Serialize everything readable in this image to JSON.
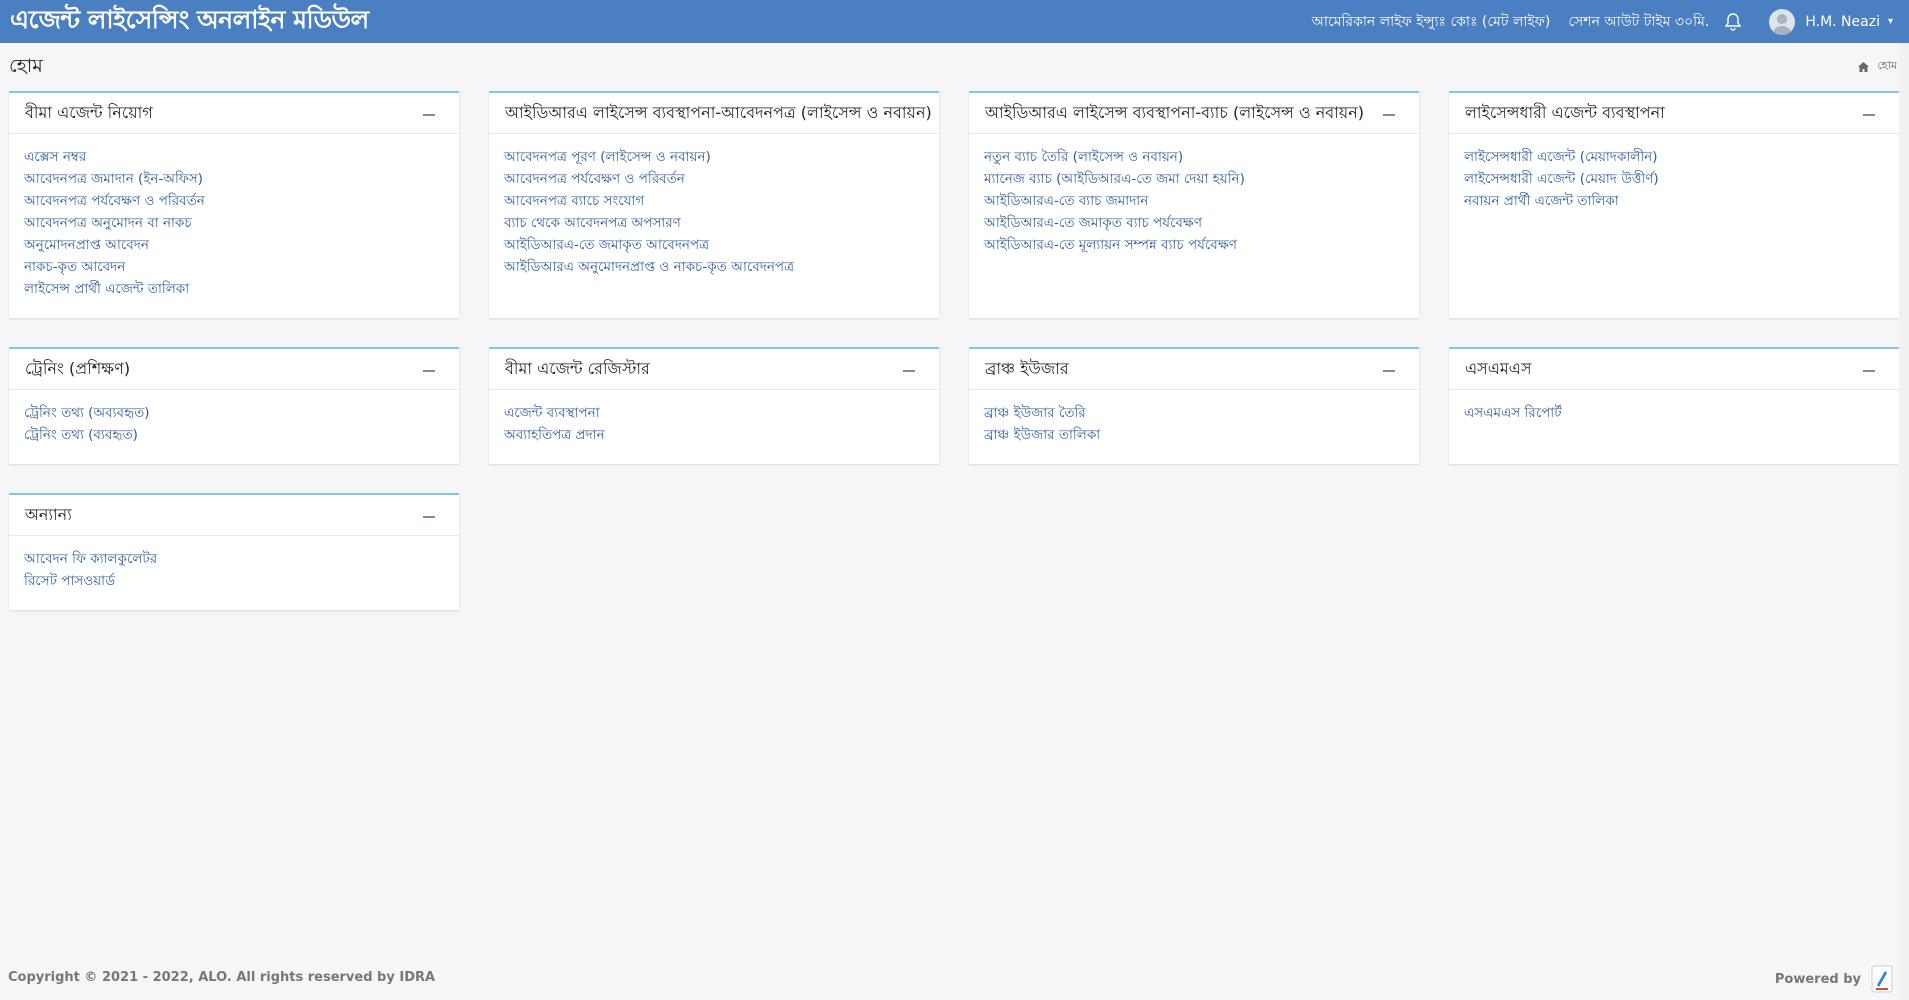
{
  "header": {
    "brand": "এজেন্ট লাইসেন্সিং অনলাইন মডিউল",
    "company": "আমেরিকান লাইফ ইন্স্যুঃ কোঃ (মেট লাইফ)",
    "session": "সেশন আউট টাইম ৩০মি.",
    "username": "H.M. Neazi",
    "icons": {
      "bell": "bell-icon",
      "avatar": "user-avatar-icon",
      "caret": "caret-down-icon"
    }
  },
  "page": {
    "title": "হোম",
    "breadcrumb": "হোম"
  },
  "cards": [
    {
      "title": "বীমা এজেন্ট নিয়োগ",
      "links": [
        "এক্সেস নম্বর",
        "আবেদনপত্র জমাদান (ইন-অফিস)",
        "আবেদনপত্র পর্যবেক্ষণ ও পরিবর্তন",
        "আবেদনপত্র অনুমোদন বা নাকচ",
        "অনুমোদনপ্রাপ্ত আবেদন",
        "নাকচ-কৃত আবেদন",
        "লাইসেন্স প্রার্থী এজেন্ট তালিকা"
      ]
    },
    {
      "title": "আইডিআরএ লাইসেন্স ব্যবস্থাপনা-আবেদনপত্র (লাইসেন্স ও নবায়ন)",
      "links": [
        "আবেদনপত্র পূরণ (লাইসেন্স ও নবায়ন)",
        "আবেদনপত্র পর্যবেক্ষণ ও পরিবর্তন",
        "আবেদনপত্র ব্যাচে সংযোগ",
        "ব্যাচ থেকে আবেদনপত্র অপসারণ",
        "আইডিআরএ-তে জমাকৃত আবেদনপত্র",
        "আইডিআরএ অনুমোদনপ্রাপ্ত ও নাকচ-কৃত আবেদনপত্র"
      ]
    },
    {
      "title": "আইডিআরএ লাইসেন্স ব্যবস্থাপনা-ব্যাচ (লাইসেন্স ও নবায়ন)",
      "links": [
        "নতুন ব্যাচ তৈরি (লাইসেন্স ও নবায়ন)",
        "ম্যানেজ ব্যাচ (আইডিআরএ-তে জমা দেয়া হয়নি)",
        "আইডিআরএ-তে ব্যাচ জমাদান",
        "আইডিআরএ-তে জমাকৃত ব্যাচ পর্যবেক্ষণ",
        "আইডিআরএ-তে মূল্যায়ন সম্পন্ন ব্যাচ পর্যবেক্ষণ"
      ]
    },
    {
      "title": "লাইসেন্সধারী এজেন্ট ব্যবস্থাপনা",
      "links": [
        "লাইসেন্সধারী এজেন্ট (মেয়াদকালীন)",
        "লাইসেন্সধারী এজেন্ট (মেয়াদ উত্তীর্ণ)",
        "নবায়ন প্রার্থী এজেন্ট তালিকা"
      ]
    },
    {
      "title": "ট্রেনিং (প্রশিক্ষণ)",
      "links": [
        "ট্রেনিং তথ্য (অব্যবহৃত)",
        "ট্রেনিং তথ্য (ব্যবহৃত)"
      ]
    },
    {
      "title": "বীমা এজেন্ট রেজিস্টার",
      "links": [
        "এজেন্ট ব্যবস্থাপনা",
        "অব্যাহতিপত্র প্রদান"
      ]
    },
    {
      "title": "ব্রাঞ্চ ইউজার",
      "links": [
        "ব্রাঞ্চ ইউজার তৈরি",
        "ব্রাঞ্চ ইউজার তালিকা"
      ]
    },
    {
      "title": "এসএমএস",
      "links": [
        "এসএমএস রিপোর্ট"
      ]
    },
    {
      "title": "অন্যান্য",
      "links": [
        "আবেদন ফি ক্যালকুলেটর",
        "রিসেট পাসওয়ার্ড"
      ]
    }
  ],
  "footer": {
    "copyright": "Copyright © 2021 - 2022, ALO. All rights reserved by IDRA",
    "powered_by": "Powered by"
  }
}
